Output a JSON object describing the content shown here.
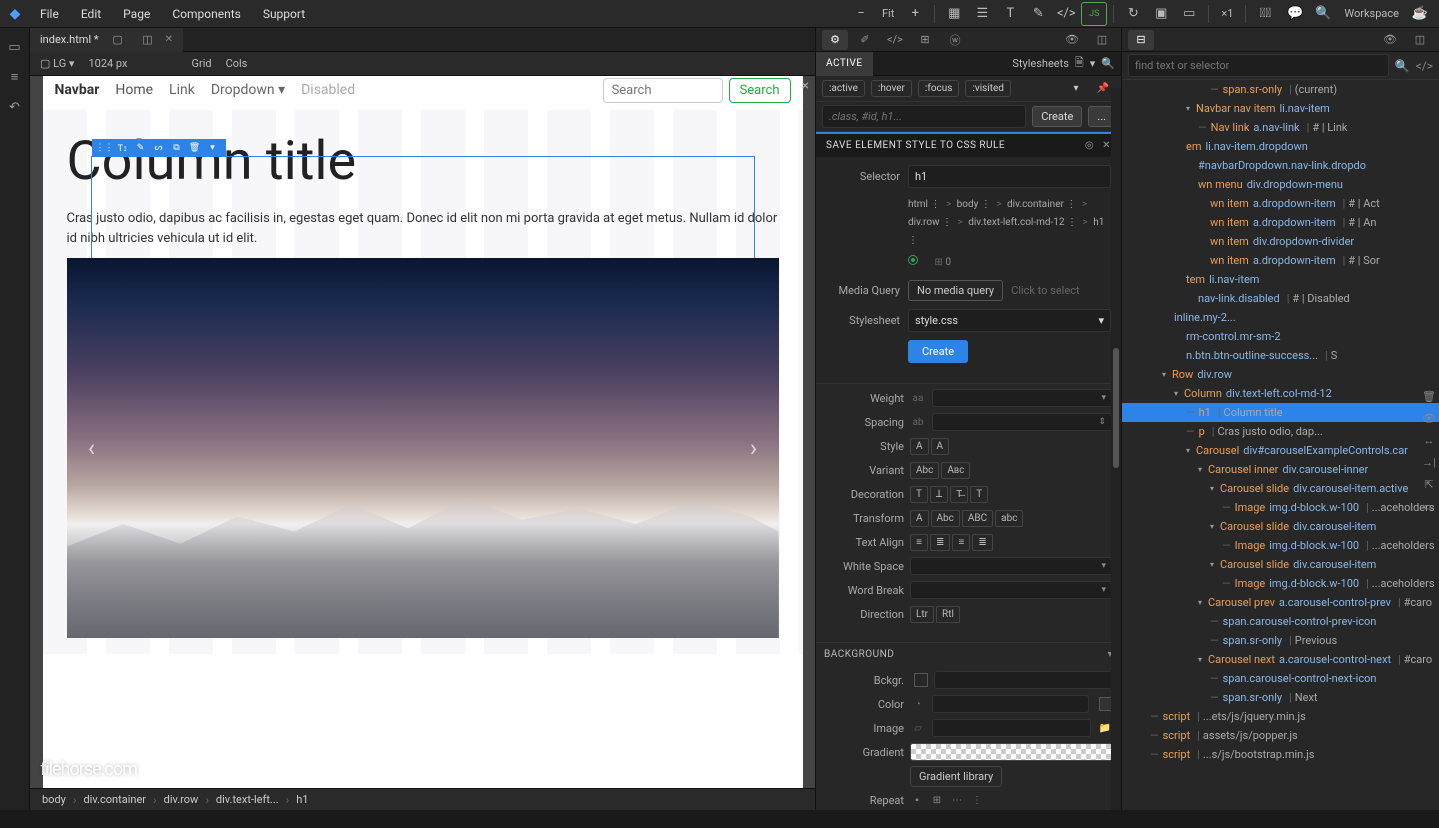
{
  "menubar": [
    "File",
    "Edit",
    "Page",
    "Components",
    "Support"
  ],
  "topbar": {
    "fit": "Fit",
    "zoom": "×1",
    "workspace": "Workspace"
  },
  "tab": {
    "name": "index.html *",
    "close": "✕"
  },
  "viewbar": {
    "size": "LG",
    "px": "1024 px",
    "grid": "Grid",
    "cols": "Cols"
  },
  "canvas": {
    "nav": {
      "brand": "Navbar",
      "items": [
        "Home",
        "Link",
        "Dropdown ▾",
        "Disabled"
      ],
      "search_placeholder": "Search",
      "search_btn": "Search"
    },
    "h1": "Column title",
    "h1_tag": "h1",
    "p": "Cras justo odio, dapibus ac facilisis in, egestas eget quam. Donec id elit non mi porta gravida at eget metus. Nullam id dolor id nibh ultricies vehicula ut id elit."
  },
  "watermark": "filehorse",
  "watermark_suffix": ".com",
  "breadcrumb": [
    "body",
    "div.container",
    "div.row",
    "div.text-left...",
    "h1"
  ],
  "midpanel": {
    "active": "ACTIVE",
    "stylesheets": "Stylesheets",
    "pseudos": [
      ":active",
      ":hover",
      ":focus",
      ":visited"
    ],
    "class_placeholder": ".class, #id, h1...",
    "create": "Create",
    "more": "...",
    "save_header": "SAVE ELEMENT STYLE TO CSS RULE",
    "selector_label": "Selector",
    "selector_value": "h1",
    "selector_crumbs": [
      "html",
      ">",
      "body",
      ">",
      "div.container",
      ">",
      "div.row",
      ">",
      "div.text-left.col-md-12",
      ">",
      "h1"
    ],
    "dots_count": "0",
    "media_label": "Media Query",
    "media_pill": "No media query",
    "media_hint": "Click to select",
    "stylesheet_label": "Stylesheet",
    "stylesheet_value": "style.css",
    "create_btn": "Create",
    "props": {
      "weight": "Weight",
      "spacing": "Spacing",
      "style": "Style",
      "variant": "Variant",
      "decoration": "Decoration",
      "transform": "Transform",
      "textalign": "Text Align",
      "whitespace": "White Space",
      "wordbreak": "Word Break",
      "direction": "Direction"
    },
    "style_opts": [
      "A",
      "A"
    ],
    "variant_opts": [
      "Abc",
      "Aʙᴄ"
    ],
    "deco_opts": [
      "T",
      "ꓕ",
      "T̶",
      "T"
    ],
    "trans_opts": [
      "A",
      "Abc",
      "ABC",
      "abc"
    ],
    "dir_opts": [
      "Ltr",
      "Rtl"
    ],
    "bg_header": "BACKGROUND",
    "bckgr": "Bckgr.",
    "color": "Color",
    "image": "Image",
    "gradient": "Gradient",
    "gradlib": "Gradient library",
    "repeat": "Repeat"
  },
  "rightpanel": {
    "search_placeholder": "find text or selector",
    "tree": [
      {
        "indent": 7,
        "dash": true,
        "tag": "span.sr-only",
        "pipe": "(current)"
      },
      {
        "indent": 5,
        "exp": "▾",
        "tag": "Navbar nav item",
        "sel": "li.nav-item"
      },
      {
        "indent": 6,
        "dash": true,
        "tag": "Nav link",
        "sel": "a.nav-link",
        "pipe": "# | Link"
      },
      {
        "indent": 5,
        "tag": "em",
        "sel": "li.nav-item.dropdown"
      },
      {
        "indent": 6,
        "tag": "",
        "sel": "#navbarDropdown.nav-link.dropdo"
      },
      {
        "indent": 6,
        "tag": "wn menu",
        "sel": "div.dropdown-menu"
      },
      {
        "indent": 7,
        "tag": "wn item",
        "sel": "a.dropdown-item",
        "pipe": "# | Act"
      },
      {
        "indent": 7,
        "tag": "wn item",
        "sel": "a.dropdown-item",
        "pipe": "# | An"
      },
      {
        "indent": 7,
        "tag": "wn item",
        "sel": "div.dropdown-divider"
      },
      {
        "indent": 7,
        "tag": "wn item",
        "sel": "a.dropdown-item",
        "pipe": "# | Sor"
      },
      {
        "indent": 5,
        "tag": "tem",
        "sel": "li.nav-item"
      },
      {
        "indent": 6,
        "tag": "",
        "sel": "nav-link.disabled",
        "pipe": "# | Disabled"
      },
      {
        "indent": 4,
        "tag": "",
        "sel": "inline.my-2..."
      },
      {
        "indent": 5,
        "tag": "",
        "sel": "rm-control.mr-sm-2"
      },
      {
        "indent": 5,
        "tag": "",
        "sel": "n.btn.btn-outline-success...",
        "pipe": "S"
      },
      {
        "indent": 3,
        "exp": "▾",
        "tag": "Row",
        "sel": "div.row"
      },
      {
        "indent": 4,
        "exp": "▾",
        "tag": "Column",
        "sel": "div.text-left.col-md-12"
      },
      {
        "indent": 5,
        "dash": true,
        "tag": "h1",
        "pipe": "Column title",
        "selected": true
      },
      {
        "indent": 5,
        "dash": true,
        "tag": "p",
        "pipe": "Cras justo odio, dap..."
      },
      {
        "indent": 5,
        "exp": "▾",
        "tag": "Carousel",
        "sel": "div#carouselExampleControls.car"
      },
      {
        "indent": 6,
        "exp": "▾",
        "tag": "Carousel inner",
        "sel": "div.carousel-inner"
      },
      {
        "indent": 7,
        "exp": "▾",
        "tag": "Carousel slide",
        "sel": "div.carousel-item.active"
      },
      {
        "indent": 8,
        "dash": true,
        "tag": "Image",
        "sel": "img.d-block.w-100",
        "pipe": "...aceholders"
      },
      {
        "indent": 7,
        "exp": "▾",
        "tag": "Carousel slide",
        "sel": "div.carousel-item"
      },
      {
        "indent": 8,
        "dash": true,
        "tag": "Image",
        "sel": "img.d-block.w-100",
        "pipe": "...aceholders"
      },
      {
        "indent": 7,
        "exp": "▾",
        "tag": "Carousel slide",
        "sel": "div.carousel-item"
      },
      {
        "indent": 8,
        "dash": true,
        "tag": "Image",
        "sel": "img.d-block.w-100",
        "pipe": "...aceholders"
      },
      {
        "indent": 6,
        "exp": "▾",
        "tag": "Carousel prev",
        "sel": "a.carousel-control-prev",
        "pipe": "#caro"
      },
      {
        "indent": 7,
        "dash": true,
        "tag": "",
        "sel": "span.carousel-control-prev-icon"
      },
      {
        "indent": 7,
        "dash": true,
        "tag": "",
        "sel": "span.sr-only",
        "pipe": "Previous"
      },
      {
        "indent": 6,
        "exp": "▾",
        "tag": "Carousel next",
        "sel": "a.carousel-control-next",
        "pipe": "#caro"
      },
      {
        "indent": 7,
        "dash": true,
        "tag": "",
        "sel": "span.carousel-control-next-icon"
      },
      {
        "indent": 7,
        "dash": true,
        "tag": "",
        "sel": "span.sr-only",
        "pipe": "Next"
      },
      {
        "indent": 2,
        "dash": true,
        "tag": "script",
        "pipe": "...ets/js/jquery.min.js"
      },
      {
        "indent": 2,
        "dash": true,
        "tag": "script",
        "pipe": "assets/js/popper.js"
      },
      {
        "indent": 2,
        "dash": true,
        "tag": "script",
        "pipe": "...s/js/bootstrap.min.js"
      }
    ]
  }
}
